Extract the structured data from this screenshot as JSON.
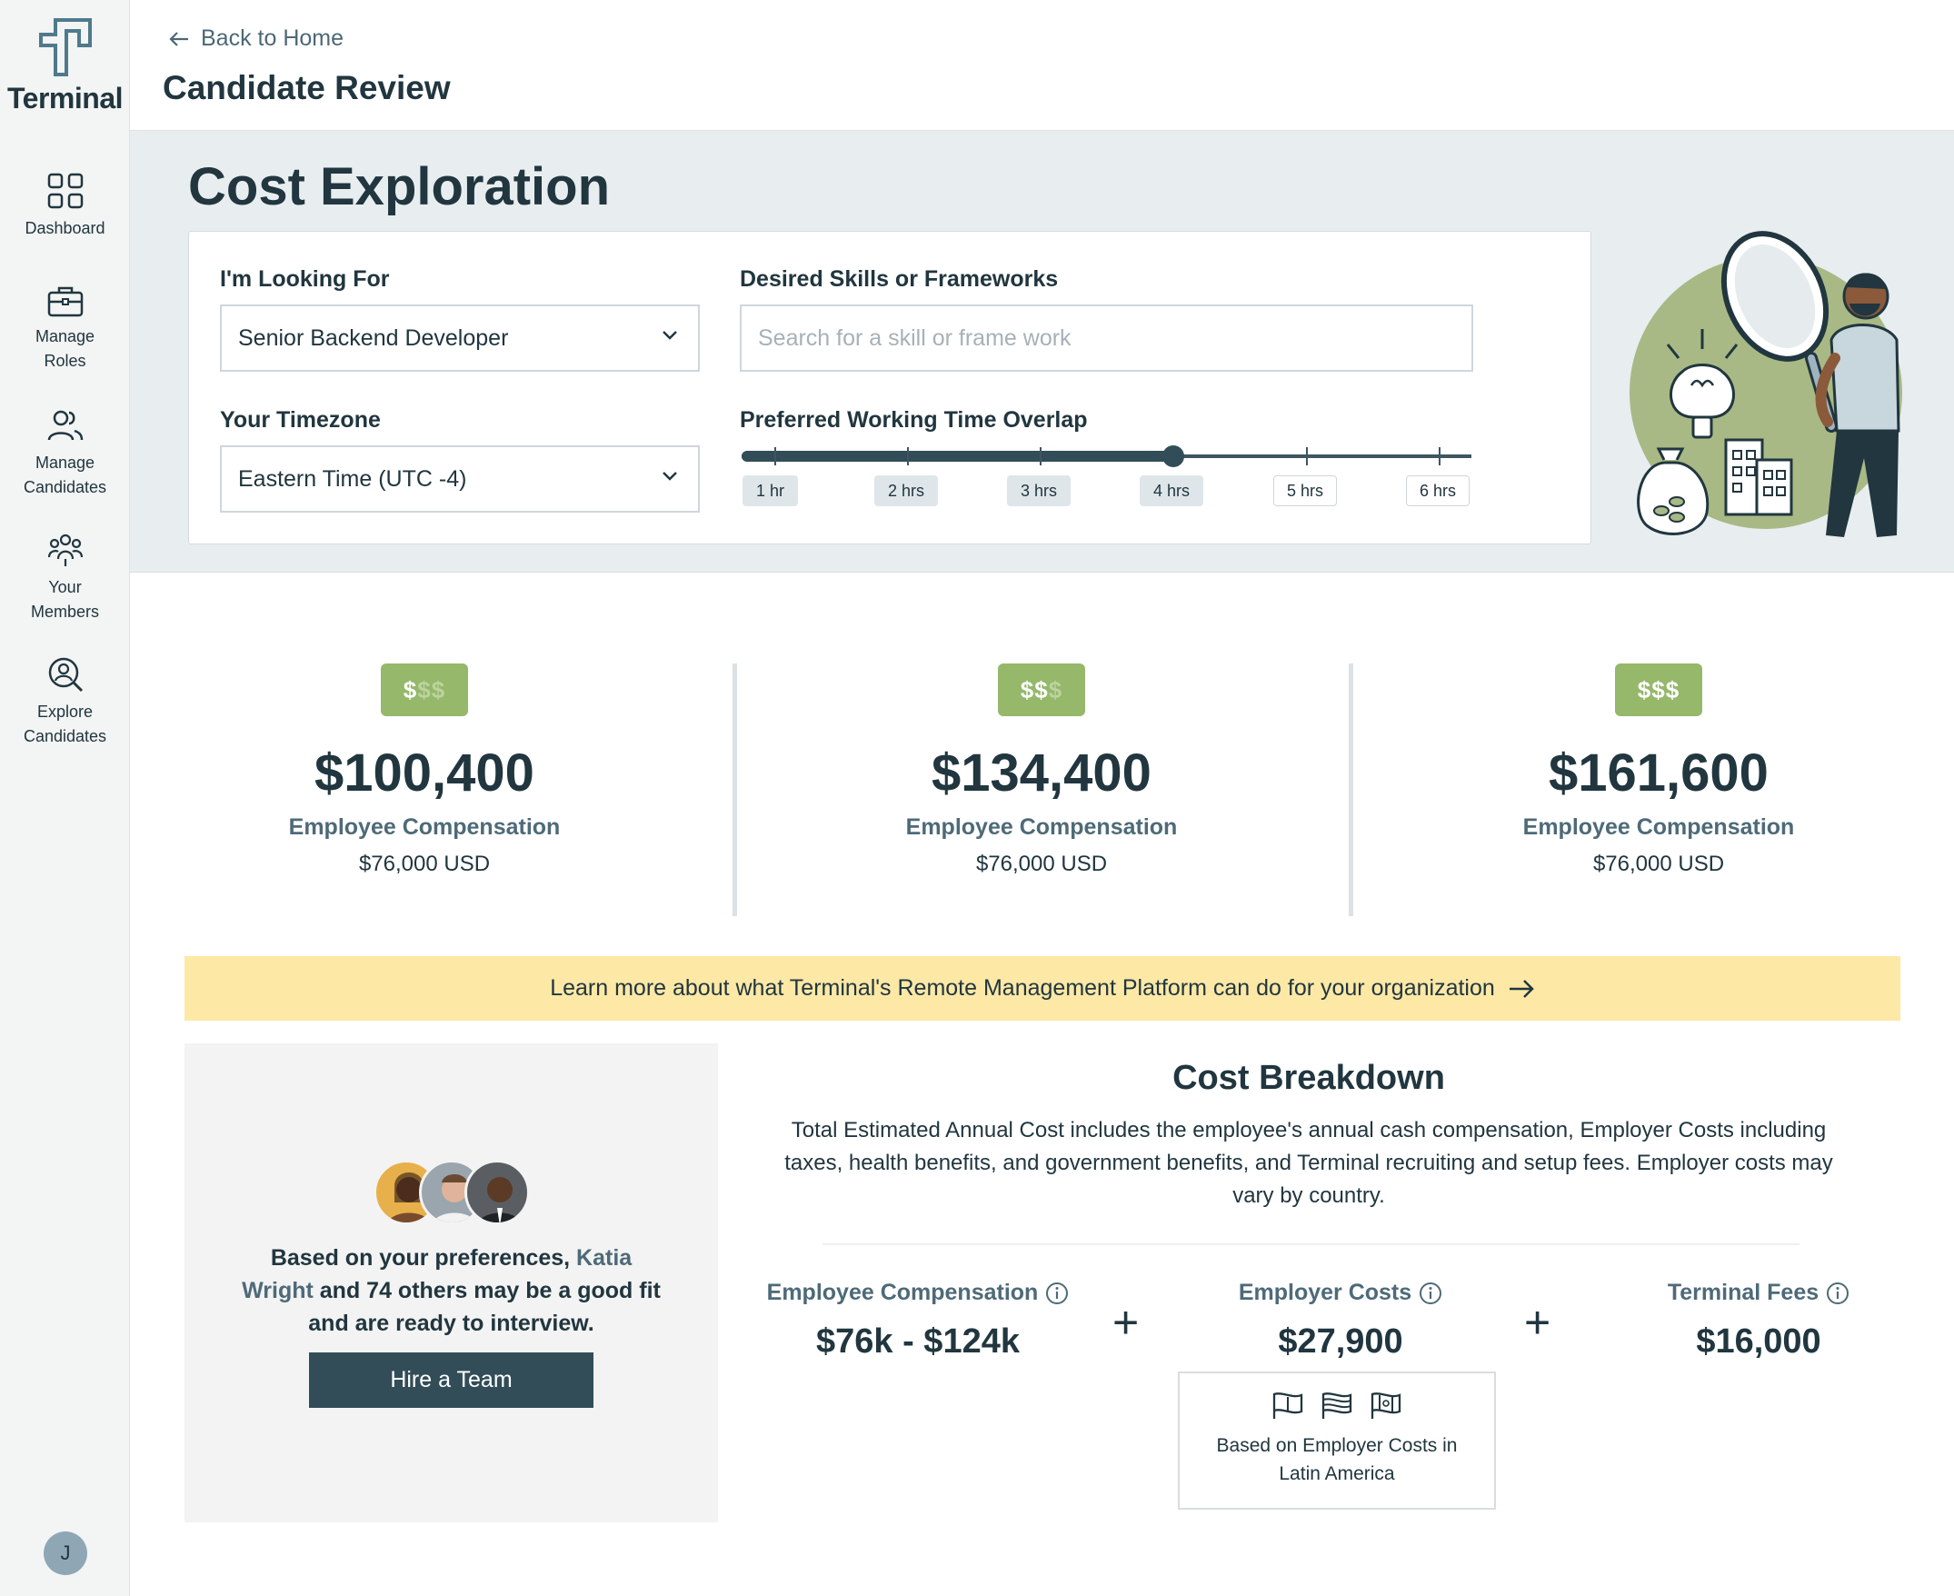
{
  "app": {
    "name": "Terminal"
  },
  "sidebar": {
    "items": [
      {
        "label": "Dashboard",
        "icon": "grid-icon"
      },
      {
        "label": "Manage\nRoles",
        "icon": "briefcase-icon"
      },
      {
        "label": "Manage\nCandidates",
        "icon": "users-icon"
      },
      {
        "label": "Your\nMembers",
        "icon": "team-icon"
      },
      {
        "label": "Explore\nCandidates",
        "icon": "search-person-icon"
      }
    ],
    "user_initial": "J"
  },
  "header": {
    "back_label": "Back to Home",
    "title": "Candidate Review"
  },
  "hero": {
    "title": "Cost Exploration",
    "looking_for_label": "I'm Looking For",
    "looking_for_value": "Senior Backend Developer",
    "skills_label": "Desired Skills or Frameworks",
    "skills_placeholder": "Search for a skill or frame work",
    "timezone_label": "Your Timezone",
    "timezone_value": "Eastern Time (UTC -4)",
    "overlap_label": "Preferred Working Time Overlap",
    "overlap_options": [
      "1 hr",
      "2 hrs",
      "3 hrs",
      "4 hrs",
      "5 hrs",
      "6 hrs"
    ],
    "overlap_selected": "4 hrs"
  },
  "tiers": [
    {
      "badge_on": "$",
      "badge_off": "$$",
      "price": "$100,400",
      "label": "Employee Compensation",
      "value": "$76,000 USD"
    },
    {
      "badge_on": "$$",
      "badge_off": "$",
      "price": "$134,400",
      "label": "Employee Compensation",
      "value": "$76,000 USD"
    },
    {
      "badge_on": "$$$",
      "badge_off": "",
      "price": "$161,600",
      "label": "Employee Compensation",
      "value": "$76,000 USD"
    }
  ],
  "banner": {
    "text": "Learn more about what Terminal's Remote Management Platform can do for your organization"
  },
  "team": {
    "text_before": "Based on your preferences, ",
    "highlight": "Katia Wright",
    "text_after": " and 74 others may be a good fit and are ready to interview.",
    "button": "Hire a Team"
  },
  "breakdown": {
    "title": "Cost Breakdown",
    "description": "Total Estimated Annual Cost includes the employee's annual cash compensation, Employer Costs including taxes, health benefits, and government benefits, and Terminal recruiting and setup fees. Employer costs may vary by country.",
    "items": [
      {
        "label": "Employee Compensation",
        "value": "$76k - $124k"
      },
      {
        "label": "Employer Costs",
        "value": "$27,900"
      },
      {
        "label": "Terminal Fees",
        "value": "$16,000"
      }
    ],
    "plus": "+",
    "region_text": "Based on Employer Costs in Latin America"
  },
  "colors": {
    "primary": "#324d58",
    "accent_green": "#95b86b",
    "banner": "#fde8a6",
    "hero_bg": "#e8edf0"
  }
}
